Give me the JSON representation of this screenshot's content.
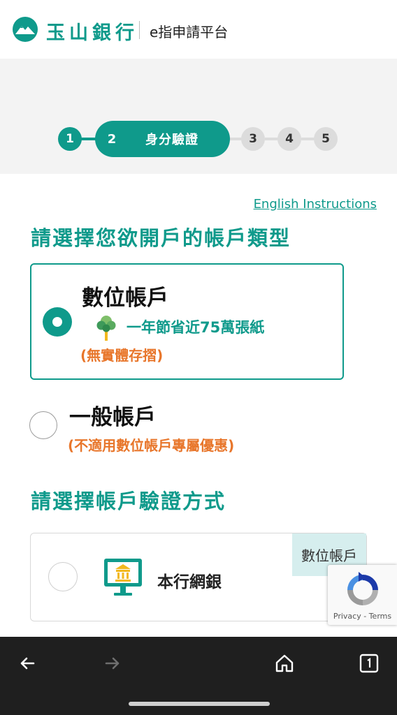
{
  "header": {
    "brand_name": "玉山銀行",
    "platform_title": "e指申請平台"
  },
  "stepper": {
    "steps": [
      {
        "number": "1",
        "state": "done"
      },
      {
        "number": "2",
        "label": "身分驗證",
        "state": "active"
      },
      {
        "number": "3",
        "state": "todo"
      },
      {
        "number": "4",
        "state": "todo"
      },
      {
        "number": "5",
        "state": "todo"
      }
    ]
  },
  "links": {
    "english_instructions": "English Instructions"
  },
  "account_type": {
    "heading": "請選擇您欲開戶的帳戶類型",
    "options": [
      {
        "title": "數位帳戶",
        "eco_text": "一年節省近75萬張紙",
        "note": "(無實體存摺)",
        "selected": true
      },
      {
        "title": "一般帳戶",
        "note": "(不適用數位帳戶專屬優惠)",
        "selected": false
      }
    ]
  },
  "verification": {
    "heading": "請選擇帳戶驗證方式",
    "options": [
      {
        "label": "本行網銀",
        "tag": "數位帳戶",
        "icon": "bank-monitor-icon"
      }
    ]
  },
  "recaptcha": {
    "text": "Privacy - Terms"
  },
  "colors": {
    "brand": "#0f9a8b",
    "note": "#e8762b",
    "tag_bg": "#d6eeee"
  }
}
